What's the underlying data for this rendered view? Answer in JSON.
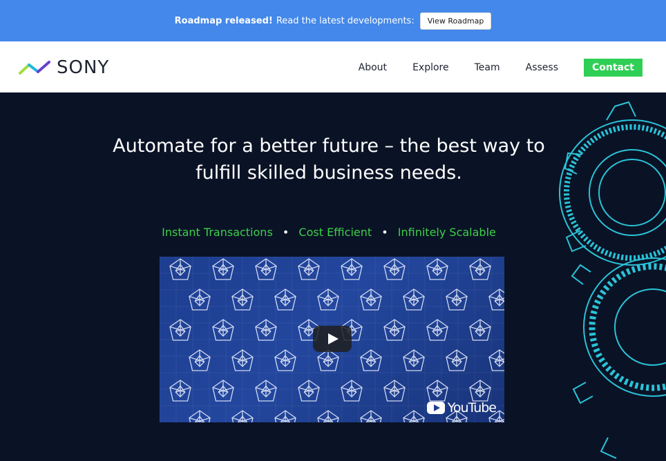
{
  "banner": {
    "bold": "Roadmap released!",
    "text": "Read the latest developments:",
    "button": "View Roadmap"
  },
  "brand": {
    "name": "SONY",
    "logo_icon": "zigzag-logo-icon"
  },
  "nav": {
    "items": [
      "About",
      "Explore",
      "Team",
      "Assess"
    ],
    "contact": "Contact"
  },
  "hero": {
    "headline": "Automate for a better future – the best way to fulfill skilled business needs.",
    "tags": [
      "Instant Transactions",
      "Cost Efficient",
      "Infinitely Scalable"
    ],
    "separator": "•"
  },
  "video": {
    "platform": "YouTube",
    "play_icon": "play-icon"
  },
  "colors": {
    "banner": "#4388ea",
    "hero_bg": "#0a1325",
    "accent_green": "#2fcf55",
    "gear": "#2bc3d9"
  }
}
